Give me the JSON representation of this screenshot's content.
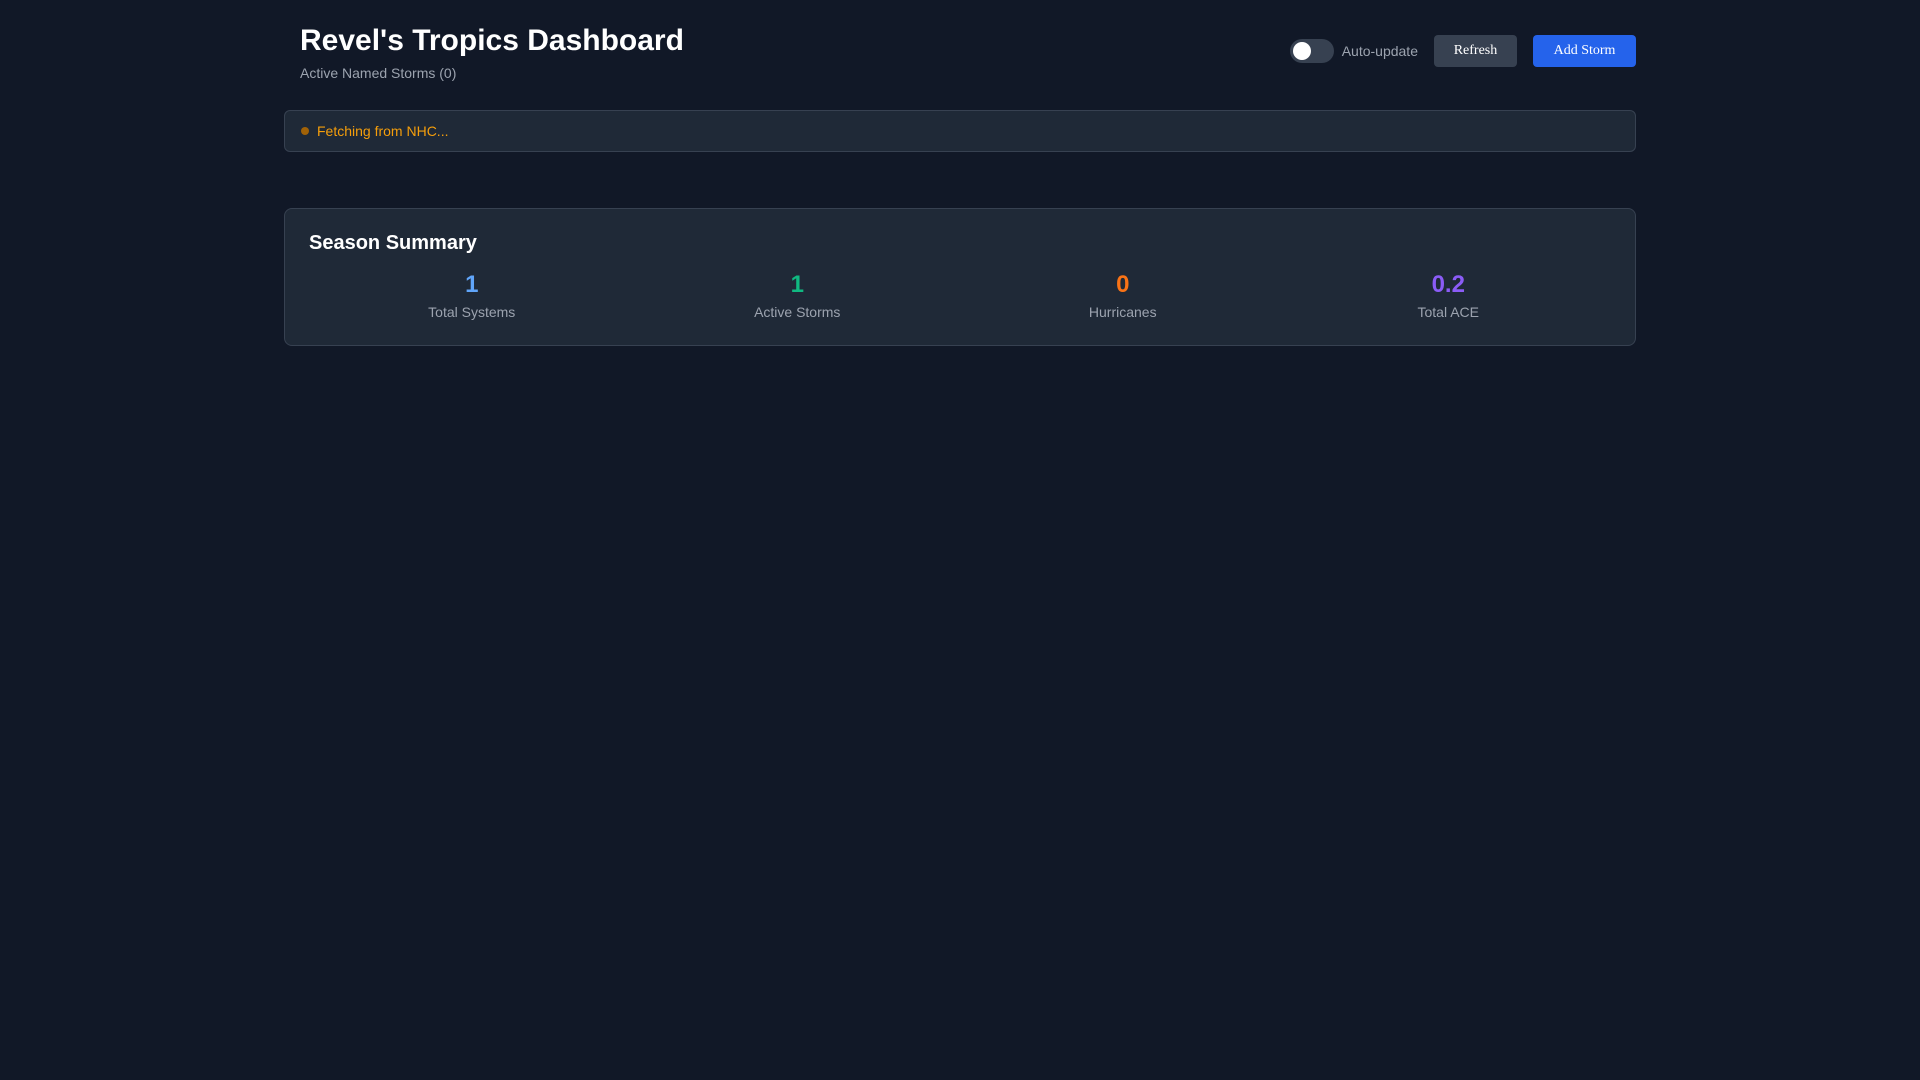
{
  "header": {
    "title": "Revel's Tropics Dashboard",
    "subtitle": "Active Named Storms (0)"
  },
  "controls": {
    "auto_update_label": "Auto-update",
    "auto_update_on": false,
    "refresh_label": "Refresh",
    "add_storm_label": "Add Storm"
  },
  "status": {
    "text": "Fetching from NHC...",
    "color": "#f59e0b"
  },
  "summary": {
    "title": "Season Summary",
    "stats": [
      {
        "value": "1",
        "label": "Total Systems",
        "color": "#60a5fa"
      },
      {
        "value": "1",
        "label": "Active Storms",
        "color": "#10b981"
      },
      {
        "value": "0",
        "label": "Hurricanes",
        "color": "#f97316"
      },
      {
        "value": "0.2",
        "label": "Total ACE",
        "color": "#8b5cf6"
      }
    ]
  }
}
